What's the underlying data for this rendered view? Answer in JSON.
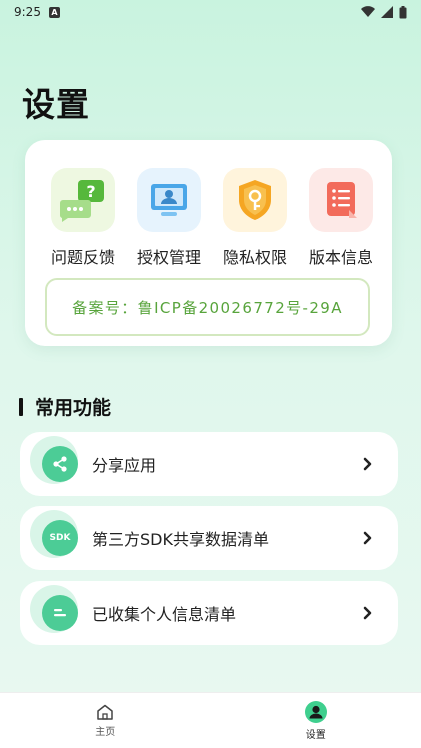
{
  "status_bar": {
    "time": "9:25",
    "notif_letter": "A"
  },
  "page": {
    "title": "设置"
  },
  "quick_actions": [
    {
      "label": "问题反馈",
      "icon": "feedback-chat-icon"
    },
    {
      "label": "授权管理",
      "icon": "monitor-user-icon"
    },
    {
      "label": "隐私权限",
      "icon": "shield-key-icon"
    },
    {
      "label": "版本信息",
      "icon": "document-list-icon"
    }
  ],
  "record": {
    "text": "备案号：鲁ICP备20026772号-29A"
  },
  "section": {
    "title": "常用功能"
  },
  "list": [
    {
      "label": "分享应用",
      "icon": "share-icon"
    },
    {
      "label": "第三方SDK共享数据清单",
      "icon": "sdk-icon",
      "icon_text": "SDK"
    },
    {
      "label": "已收集个人信息清单",
      "icon": "info-list-icon"
    }
  ],
  "nav": {
    "home": {
      "label": "主页"
    },
    "settings": {
      "label": "设置"
    }
  },
  "colors": {
    "accent": "#4ccc96",
    "record_text": "#58a43c",
    "record_border": "#d3e8bf"
  }
}
